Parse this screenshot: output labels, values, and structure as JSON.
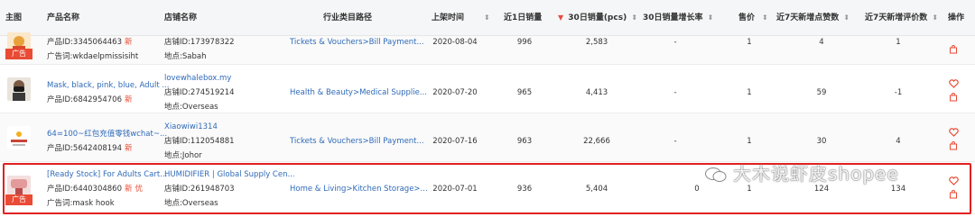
{
  "header": {
    "col_main_image": "主图",
    "col_product_name": "产品名称",
    "col_shop_name": "店铺名称",
    "col_category": "行业类目路径",
    "col_listed": "上架时间",
    "col_sales_1d": "近1日销量",
    "col_sales_30d": "30日销量(pcs)",
    "col_growth_30d": "30日销量增长率",
    "col_price": "售价",
    "col_likes_7d": "近7天新增点赞数",
    "col_reviews_7d": "近7天新增评价数",
    "col_action": "操作",
    "sort_glyph": "⬍",
    "sort_active_glyph": "▼"
  },
  "rows": [
    {
      "ad_label": "广告",
      "product_name": "",
      "product_id": "产品ID:3345064463",
      "new_badge": "新",
      "extra_badge": "",
      "ad_keyword": "广告词:wkdaelpmissisiht",
      "shop_name": "",
      "shop_id": "店铺ID:173978322",
      "location": "地点:Sabah",
      "category": "Tickets & Vouchers>Bill Payment...",
      "listed": "2020-08-04",
      "sales_1d": "996",
      "sales_30d": "2,583",
      "growth": "-",
      "price": "1",
      "likes_7d": "4",
      "reviews_7d": "1"
    },
    {
      "ad_label": "",
      "product_name": "Mask, black, pink, blue, Adult ...",
      "product_id": "产品ID:6842954706",
      "new_badge": "新",
      "extra_badge": "",
      "ad_keyword": "",
      "shop_name": "lovewhalebox.my",
      "shop_id": "店铺ID:274519214",
      "location": "地点:Overseas",
      "category": "Health & Beauty>Medical Supplie...",
      "listed": "2020-07-20",
      "sales_1d": "965",
      "sales_30d": "4,413",
      "growth": "-",
      "price": "1",
      "likes_7d": "59",
      "reviews_7d": "-1"
    },
    {
      "ad_label": "",
      "product_name": "64=100~红包充值零钱wchat~...",
      "product_id": "产品ID:5642408194",
      "new_badge": "新",
      "extra_badge": "",
      "ad_keyword": "",
      "shop_name": "Xiaowiwi1314",
      "shop_id": "店铺ID:112054881",
      "location": "地点:Johor",
      "category": "Tickets & Vouchers>Bill Payment...",
      "listed": "2020-07-16",
      "sales_1d": "963",
      "sales_30d": "22,666",
      "growth": "-",
      "price": "1",
      "likes_7d": "30",
      "reviews_7d": "4"
    },
    {
      "ad_label": "广告",
      "product_name": "[Ready Stock] For Adults Cart...",
      "product_id": "产品ID:6440304860",
      "new_badge": "新",
      "extra_badge": "优",
      "ad_keyword": "广告词:mask hook",
      "shop_name": "HUMIDIFIER | Global Supply Cen...",
      "shop_id": "店铺ID:261948703",
      "location": "地点:Overseas",
      "category": "Home & Living>Kitchen Storage>...",
      "listed": "2020-07-01",
      "sales_1d": "936",
      "sales_30d": "5,404",
      "growth": "0",
      "price": "1",
      "likes_7d": "124",
      "reviews_7d": "134"
    }
  ],
  "watermark": "大木说虾皮shopee",
  "icons": {
    "favorite": "heart-icon",
    "shop": "shopping-bag-icon",
    "watermark_logo": "wechat-icon"
  },
  "colors": {
    "accent_red": "#e94b35",
    "link_blue": "#2f6ab8",
    "highlight_border": "#e02020"
  }
}
